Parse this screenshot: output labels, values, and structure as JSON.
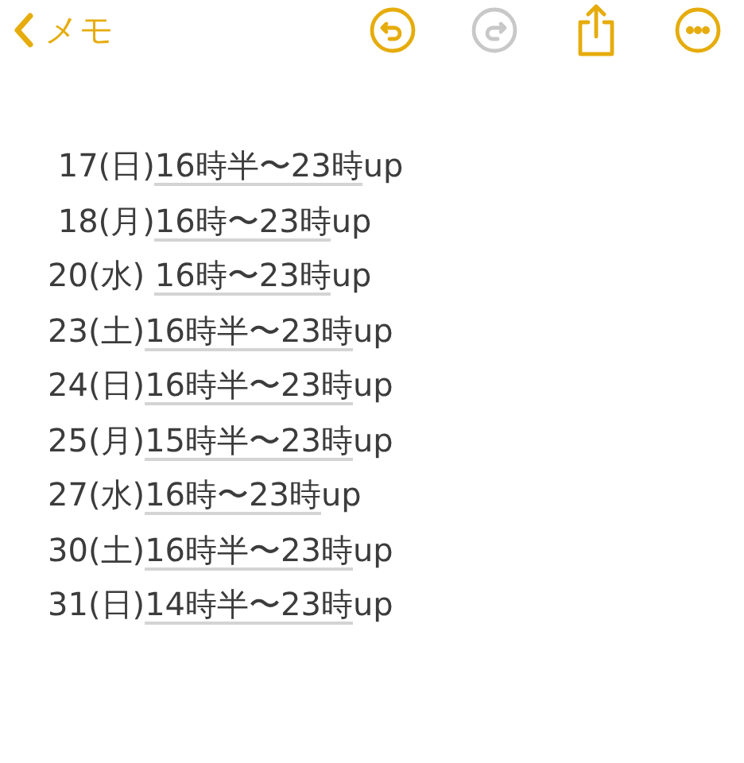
{
  "toolbar": {
    "back_label": "メモ",
    "buttons": [
      {
        "kind": "undo",
        "disabled": false
      },
      {
        "kind": "redo",
        "disabled": true
      },
      {
        "kind": "share",
        "disabled": false
      },
      {
        "kind": "more",
        "disabled": false
      }
    ]
  },
  "lines": [
    {
      "date": " 17(日)",
      "time": "16時半〜23時",
      "suffix": "up"
    },
    {
      "date": " 18(月)",
      "time": "16時〜23時",
      "suffix": "up"
    },
    {
      "date": "20(水) ",
      "time": "16時〜23時",
      "suffix": "up"
    },
    {
      "date": "23(土)",
      "time": "16時半〜23時",
      "suffix": "up"
    },
    {
      "date": "24(日)",
      "time": "16時半〜23時",
      "suffix": "up"
    },
    {
      "date": "25(月)",
      "time": "15時半〜23時",
      "suffix": "up"
    },
    {
      "date": "27(水)",
      "time": "16時〜23時",
      "suffix": "up"
    },
    {
      "date": "30(土)",
      "time": "16時半〜23時",
      "suffix": "up"
    },
    {
      "date": "31(日)",
      "time": "14時半〜23時",
      "suffix": "up"
    }
  ]
}
